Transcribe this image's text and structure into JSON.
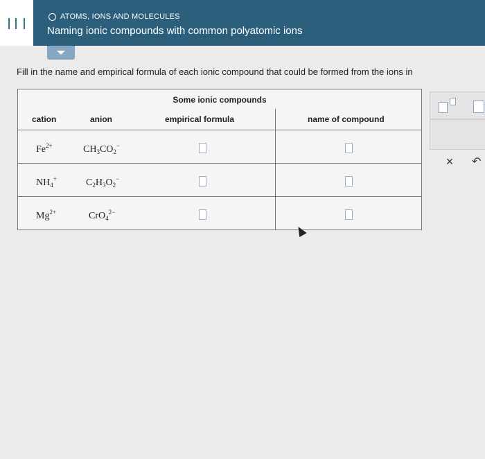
{
  "header": {
    "topic": "ATOMS, IONS AND MOLECULES",
    "title": "Naming ionic compounds with common polyatomic ions"
  },
  "instructions": "Fill in the name and empirical formula of each ionic compound that could be formed from the ions in",
  "table": {
    "caption": "Some ionic compounds",
    "columns": [
      "cation",
      "anion",
      "empirical formula",
      "name of compound"
    ],
    "rows": [
      {
        "cation": "Fe",
        "cation_charge": "2+",
        "anion_parts": [
          "CH",
          "3",
          "CO",
          "2",
          "−"
        ]
      },
      {
        "cation": "NH",
        "cation_sub": "4",
        "cation_charge": "+",
        "anion_parts": [
          "C",
          "2",
          "H",
          "3",
          "O",
          "2",
          "−"
        ]
      },
      {
        "cation": "Mg",
        "cation_charge": "2+",
        "anion_parts": [
          "CrO",
          "4",
          "2−"
        ]
      }
    ]
  },
  "side_panel": {
    "clear_label": "×",
    "undo_label": "↶"
  },
  "icons": {
    "menu": "menu-icon",
    "topic_marker": "circle-icon",
    "collapse": "chevron-down-icon",
    "cursor": "cursor-icon"
  }
}
